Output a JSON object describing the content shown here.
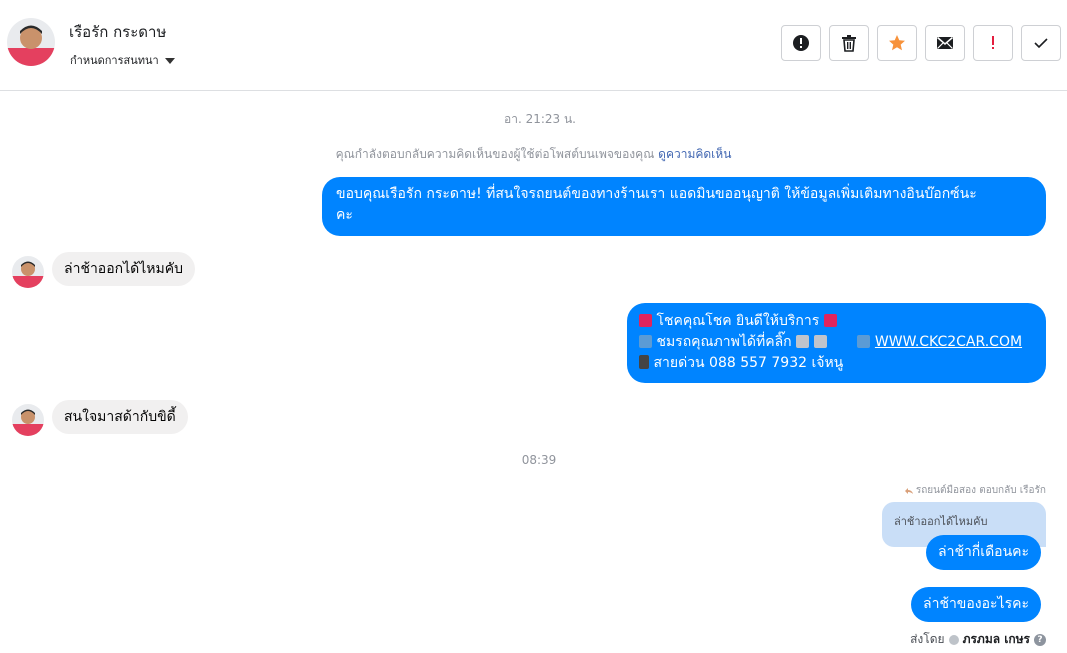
{
  "header": {
    "contact_name": "เรือรัก กระดาษ",
    "conversation_label": "กำหนดการสนทนา",
    "actions": [
      {
        "icon": "alert-circle-icon",
        "name": "report-button"
      },
      {
        "icon": "trash-icon",
        "name": "delete-button"
      },
      {
        "icon": "star-icon",
        "name": "star-button"
      },
      {
        "icon": "envelope-icon",
        "name": "mark-unread-button"
      },
      {
        "icon": "exclamation-icon",
        "name": "follow-up-button"
      },
      {
        "icon": "check-icon",
        "name": "done-button"
      }
    ],
    "accent_colors": {
      "star": "#f7923b",
      "follow_up": "#e41e3f",
      "bubble_out": "#0084ff"
    }
  },
  "thread": {
    "timestamp_1": "อา. 21:23 น.",
    "notice_text": "คุณกำลังตอบกลับความคิดเห็นของผู้ใช้ต่อโพสต์บนเพจของคุณ",
    "notice_link": "ดูความคิดเห็น",
    "msg_out_1": "ขอบคุณเรือรัก กระดาษ! ที่สนใจรถยนต์ของทางร้านเรา แอดมินขออนุญาติ ให้ข้อมูลเพิ่มเติมทางอินบ๊อกซ์นะ",
    "msg_out_1b": "คะ",
    "msg_in_1": "ล่าช้าออกได้ไหมคับ",
    "msg_out_2": {
      "line1": "โชคคุณโชค ยินดีให้บริการ",
      "line2": "ชมรถคุณภาพได้ที่คลิ๊ก",
      "link": "WWW.CKC2CAR.COM",
      "line3": "สายด่วน 088 557 7932 เจ้หนู"
    },
    "msg_in_2": "สนใจมาสด้ากับขิดี้",
    "timestamp_2": "08:39",
    "reply_meta": "รถยนต์มือสอง ตอบกลับ เรือรัก",
    "quoted_text": "ล่าช้าออกได้ไหมคับ",
    "msg_out_3": "ล่าช้ากี่เดือนคะ",
    "msg_out_4": "ล่าช้าของอะไรคะ",
    "sent_by_label": "ส่งโดย",
    "sent_by_name": "ภรภมล เกษร"
  }
}
